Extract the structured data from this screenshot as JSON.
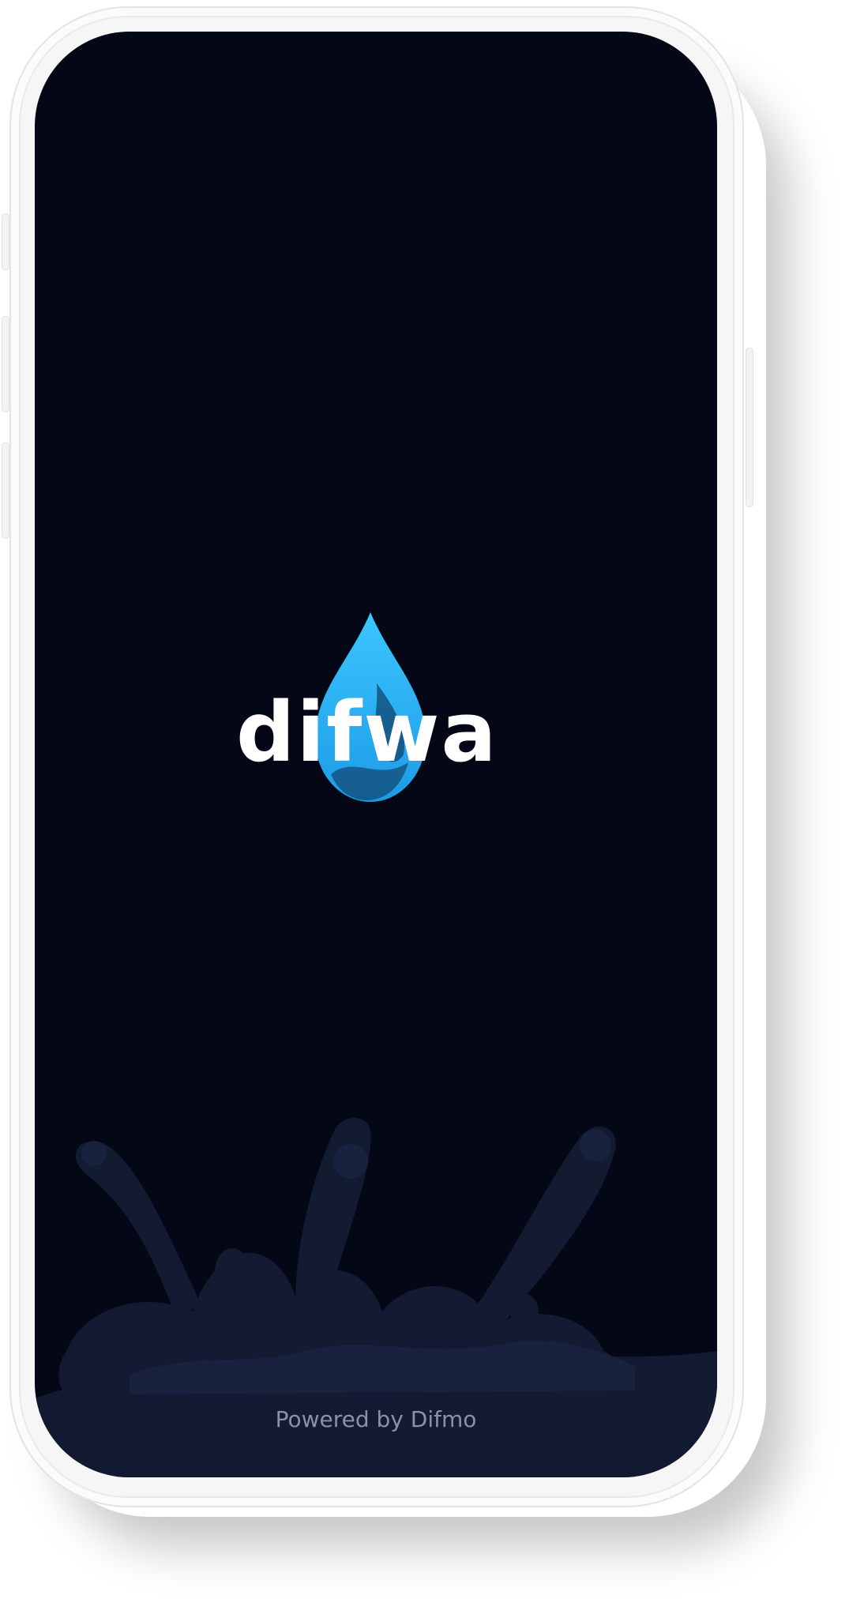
{
  "app": {
    "logo_text": "difwa",
    "footer_text": "Powered by Difmo"
  },
  "colors": {
    "screen_background": "#040816",
    "brand_blue": "#29b6f6",
    "brand_blue_dark": "#1a8fd6",
    "logo_text": "#ffffff",
    "footer_text": "#8b92a6",
    "splash": "#141c33"
  },
  "icons": {
    "logo_mark": "water-drop-icon",
    "background_art": "water-splash-illustration"
  }
}
